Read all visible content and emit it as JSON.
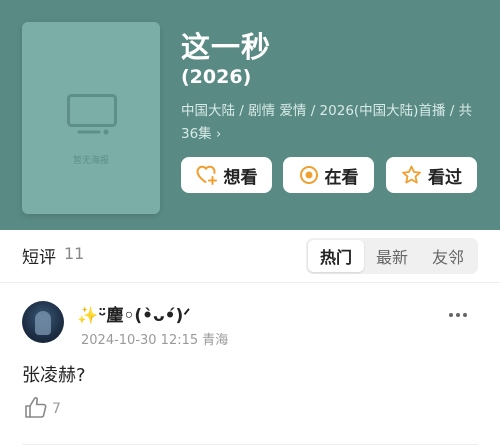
{
  "show": {
    "poster_placeholder": "暂无海报",
    "title": "这一秒",
    "year": "(2026)",
    "meta": "中国大陆 / 剧情 爱情 / 2026(中国大陆)首播 / 共36集",
    "meta_chevron": "›"
  },
  "actions": {
    "want": "想看",
    "doing": "在看",
    "done": "看过"
  },
  "reviews": {
    "title": "短评",
    "count": "11",
    "tabs": [
      "热门",
      "最新",
      "友邻"
    ],
    "active_tab": "热门"
  },
  "comment": {
    "user_name_sparkle": "✨",
    "user_name": "ᵕ̈麈◦(•̀ᴗ•́)ᐟ",
    "date": "2024-10-30 12:15",
    "location": "青海",
    "text": "张凌赫?",
    "likes": "7"
  },
  "colors": {
    "hero_bg": "#5a8a84",
    "accent_orange": "#f0a030"
  },
  "icons": {
    "want": "heart-plus-icon",
    "doing": "target-circle-icon",
    "done": "star-icon",
    "like": "thumbs-up-icon",
    "more": "more-dots-icon",
    "placeholder": "tv-icon"
  }
}
